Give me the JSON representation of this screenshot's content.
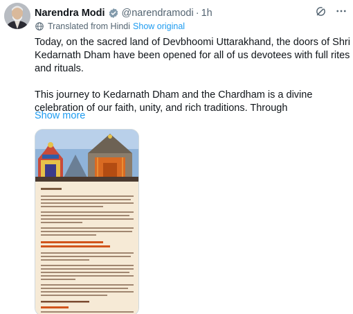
{
  "post": {
    "author_name": "Narendra Modi",
    "handle": "@narendramodi",
    "separator": "·",
    "time": "1h",
    "translation_note": "Translated from Hindi",
    "show_original_label": "Show original",
    "paragraph_1": "Today, on the sacred land of Devbhoomi Uttarakhand, the doors of Shri Kedarnath Dham have been opened for all of us devotees with full rites and rituals.",
    "paragraph_2": "This journey to Kedarnath Dham and the Chardham is a divine celebration of our faith, unity, and rich traditions. Through",
    "show_more_label": "Show more"
  },
  "icons": {
    "verified": "verified-badge-icon",
    "grok": "grok-icon",
    "more": "more-options-icon",
    "globe": "globe-icon"
  },
  "colors": {
    "accent": "#1d9bf0",
    "secondary_text": "#536471",
    "primary_text": "#0f1419",
    "letter_bg": "#f6ead6",
    "letter_heading": "#d1541b"
  }
}
